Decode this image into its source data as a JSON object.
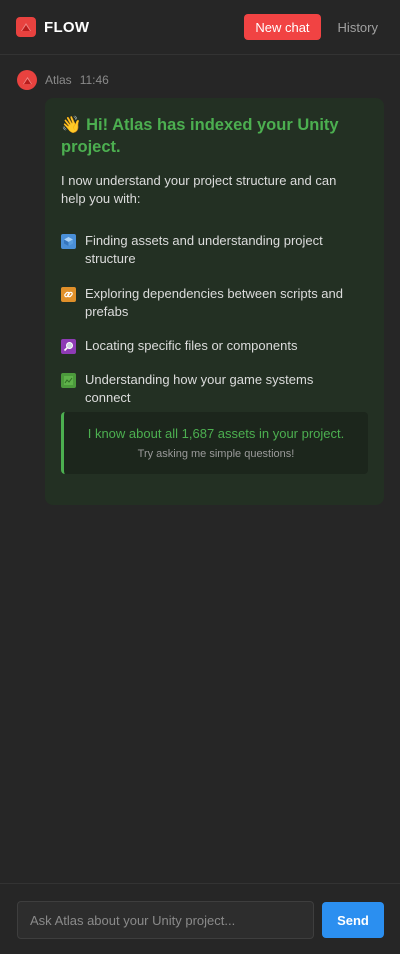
{
  "header": {
    "logo_text": "FLOW",
    "new_chat_label": "New chat",
    "history_label": "History"
  },
  "message": {
    "sender": "Atlas",
    "time": "11:46",
    "greeting_emoji": "👋",
    "greeting": "Hi! Atlas has indexed your Unity project.",
    "intro": "I now understand your project structure and can help you with:",
    "features": [
      {
        "icon": "cube-icon",
        "icon_color": "#4a8fd8",
        "label": "Finding assets and understanding project structure"
      },
      {
        "icon": "link-icon",
        "icon_color": "#e0902a",
        "label": "Exploring dependencies between scripts and prefabs"
      },
      {
        "icon": "magnifier-icon",
        "icon_color": "#8e3bb5",
        "label": "Locating specific files or components"
      },
      {
        "icon": "map-icon",
        "icon_color": "#4c9a3c",
        "label": "Understanding how your game systems connect"
      }
    ],
    "callout_main": "I know about all 1,687 assets in your project.",
    "callout_sub": "Try asking me simple questions!"
  },
  "composer": {
    "placeholder": "Ask Atlas about your Unity project...",
    "send_label": "Send"
  },
  "colors": {
    "brand_red": "#e8423f",
    "accent_green": "#4caf50",
    "send_blue": "#2b8ff0"
  }
}
